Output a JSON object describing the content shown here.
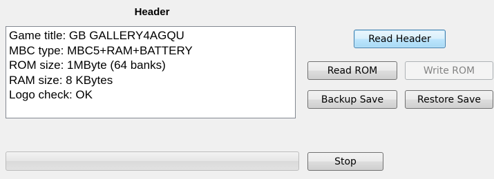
{
  "header": {
    "label": "Header",
    "lines": [
      "Game title: GB GALLERY4AGQU",
      "MBC type: MBC5+RAM+BATTERY",
      "ROM size: 1MByte (64 banks)",
      "RAM size: 8 KBytes",
      "Logo check: OK"
    ]
  },
  "buttons": {
    "read_header": "Read Header",
    "read_rom": "Read ROM",
    "write_rom": "Write ROM",
    "backup_save": "Backup Save",
    "restore_save": "Restore Save",
    "stop": "Stop"
  },
  "progress": {
    "value": 0
  }
}
